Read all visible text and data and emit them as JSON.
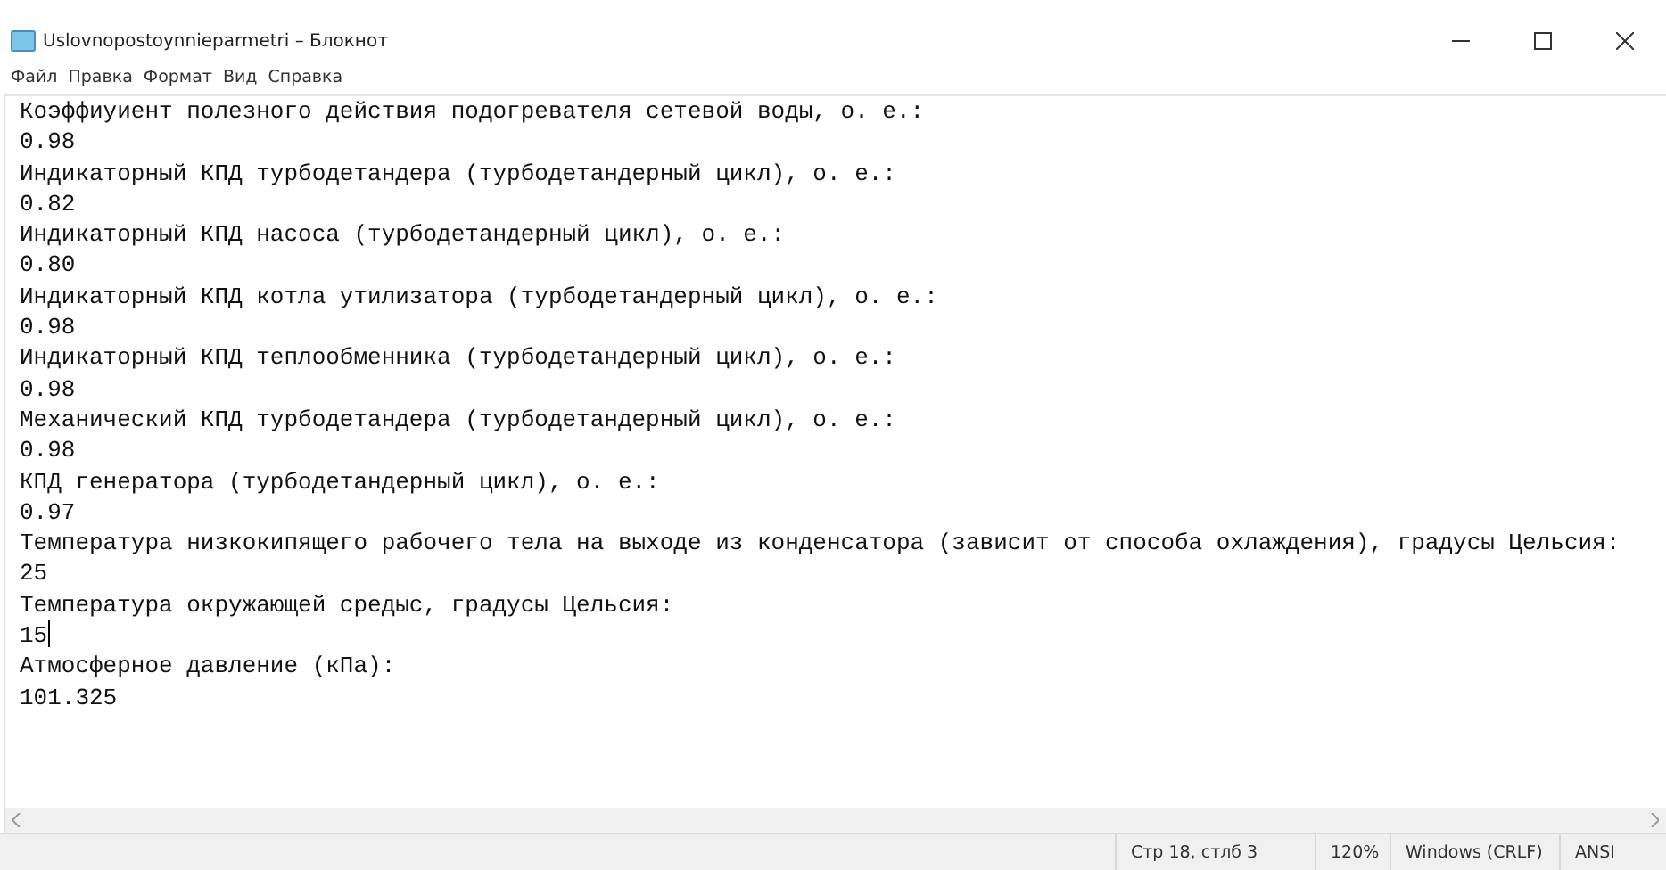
{
  "window": {
    "title": "Uslovnopostoynnieparmetri – Блокнот"
  },
  "menu": [
    "Файл",
    "Правка",
    "Формат",
    "Вид",
    "Справка"
  ],
  "lines": [
    "Коэффиуиент полезного действия подогревателя сетевой воды, о. е.:",
    "0.98",
    "Индикаторный КПД турбодетандера (турбодетандерный цикл), о. е.:",
    "0.82",
    "Индикаторный КПД насоса (турбодетандерный цикл), о. е.:",
    "0.80",
    "Индикаторный КПД котла утилизатора (турбодетандерный цикл), о. е.:",
    "0.98",
    "Индикаторный КПД теплообменника (турбодетандерный цикл), о. е.:",
    "0.98",
    "Механический КПД турбодетандера (турбодетандерный цикл), о. е.:",
    "0.98",
    "КПД генератора (турбодетандерный цикл), о. е.:",
    "0.97",
    "Температура низкокипящего рабочего тела на выходе из конденсатора (зависит от способа охлаждения), градусы Цельсия:",
    "25",
    "Температура окружающей средыс, градусы Цельсия:",
    "15",
    "Атмосферное давление (кПа):",
    "101.325"
  ],
  "status_bar": [
    "Стр 18, стлб 3",
    "120%",
    "Windows (CRLF)",
    "ANSI"
  ]
}
